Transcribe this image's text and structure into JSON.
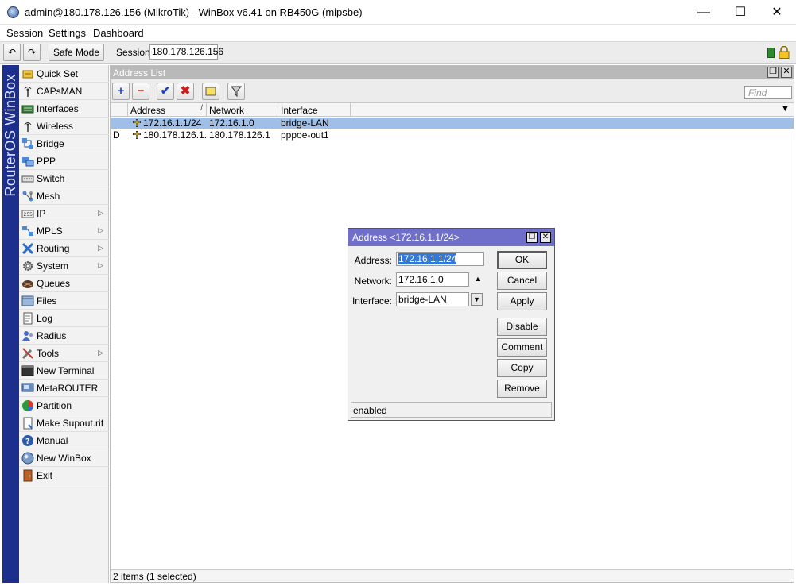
{
  "window": {
    "title": "admin@180.178.126.156 (MikroTik) - WinBox v6.41 on RB450G (mipsbe)",
    "min_glyph": "—",
    "max_glyph": "☐",
    "close_glyph": "✕"
  },
  "menu": {
    "session": "Session",
    "settings": "Settings",
    "dashboard": "Dashboard"
  },
  "toolbar": {
    "undo_glyph": "↶",
    "redo_glyph": "↷",
    "safe_mode": "Safe Mode",
    "session_label": "Session:",
    "session_value": "180.178.126.156"
  },
  "brand": {
    "text": "RouterOS WinBox"
  },
  "sidebar": {
    "items": [
      {
        "label": "Quick Set",
        "icon": "quickset-icon"
      },
      {
        "label": "CAPsMAN",
        "icon": "capsman-icon"
      },
      {
        "label": "Interfaces",
        "icon": "interfaces-icon"
      },
      {
        "label": "Wireless",
        "icon": "wireless-icon"
      },
      {
        "label": "Bridge",
        "icon": "bridge-icon"
      },
      {
        "label": "PPP",
        "icon": "ppp-icon"
      },
      {
        "label": "Switch",
        "icon": "switch-icon"
      },
      {
        "label": "Mesh",
        "icon": "mesh-icon"
      },
      {
        "label": "IP",
        "icon": "ip-icon",
        "submenu": true
      },
      {
        "label": "MPLS",
        "icon": "mpls-icon",
        "submenu": true
      },
      {
        "label": "Routing",
        "icon": "routing-icon",
        "submenu": true
      },
      {
        "label": "System",
        "icon": "system-gear-icon",
        "submenu": true
      },
      {
        "label": "Queues",
        "icon": "queues-icon"
      },
      {
        "label": "Files",
        "icon": "files-icon"
      },
      {
        "label": "Log",
        "icon": "log-icon"
      },
      {
        "label": "Radius",
        "icon": "radius-icon"
      },
      {
        "label": "Tools",
        "icon": "tools-icon",
        "submenu": true
      },
      {
        "label": "New Terminal",
        "icon": "terminal-icon"
      },
      {
        "label": "MetaROUTER",
        "icon": "metarouter-icon"
      },
      {
        "label": "Partition",
        "icon": "partition-icon"
      },
      {
        "label": "Make Supout.rif",
        "icon": "supout-icon"
      },
      {
        "label": "Manual",
        "icon": "manual-help-icon"
      },
      {
        "label": "New WinBox",
        "icon": "winbox-icon"
      },
      {
        "label": "Exit",
        "icon": "exit-door-icon"
      }
    ]
  },
  "address_list": {
    "title": "Address List",
    "restore_glyph": "❐",
    "close_glyph": "✕",
    "find_placeholder": "Find",
    "add_glyph": "+",
    "remove_glyph": "−",
    "enable_glyph": "✔",
    "disable_glyph": "✖",
    "columns": [
      "Address",
      "Network",
      "Interface"
    ],
    "sort_glyph": "/",
    "dropdown_glyph": "▼",
    "rows": [
      {
        "flag": "",
        "address": "172.16.1.1/24",
        "network": "172.16.1.0",
        "interface": "bridge-LAN",
        "selected": true
      },
      {
        "flag": "D",
        "address": "180.178.126.1...",
        "network": "180.178.126.1",
        "interface": "pppoe-out1",
        "selected": false
      }
    ],
    "status": "2 items (1 selected)"
  },
  "dialog": {
    "title": "Address <172.16.1.1/24>",
    "restore_glyph": "☐",
    "close_glyph": "✕",
    "address_label": "Address:",
    "address_value": "172.16.1.1/24",
    "network_label": "Network:",
    "network_value": "172.16.1.0",
    "interface_label": "Interface:",
    "interface_value": "bridge-LAN",
    "up_glyph": "▲",
    "down_glyph": "▼",
    "ok": "OK",
    "cancel": "Cancel",
    "apply": "Apply",
    "disable": "Disable",
    "comment": "Comment",
    "copy": "Copy",
    "remove": "Remove",
    "status": "enabled"
  }
}
